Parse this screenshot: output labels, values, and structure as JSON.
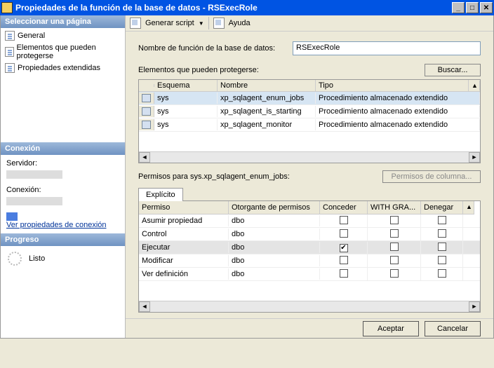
{
  "title": "Propiedades de la función de la base de datos - RSExecRole",
  "left": {
    "selectPage": "Seleccionar una página",
    "pages": [
      "General",
      "Elementos que pueden protegerse",
      "Propiedades extendidas"
    ],
    "connection": "Conexión",
    "serverLabel": "Servidor:",
    "connLabel": "Conexión:",
    "viewPropsLink": "Ver propiedades de conexión",
    "progress": "Progreso",
    "progressStatus": "Listo"
  },
  "toolbar": {
    "script": "Generar script",
    "help": "Ayuda"
  },
  "main": {
    "roleNameLabel": "Nombre de función de la base de datos:",
    "roleName": "RSExecRole",
    "securablesLabel": "Elementos que pueden protegerse:",
    "searchBtn": "Buscar...",
    "cols": {
      "schema": "Esquema",
      "name": "Nombre",
      "type": "Tipo"
    },
    "rows": [
      {
        "schema": "sys",
        "name": "xp_sqlagent_enum_jobs",
        "type": "Procedimiento almacenado extendido"
      },
      {
        "schema": "sys",
        "name": "xp_sqlagent_is_starting",
        "type": "Procedimiento almacenado extendido"
      },
      {
        "schema": "sys",
        "name": "xp_sqlagent_monitor",
        "type": "Procedimiento almacenado extendido"
      }
    ],
    "permsFor": "Permisos para sys.xp_sqlagent_enum_jobs:",
    "colPermsBtn": "Permisos de columna...",
    "tabExplicit": "Explícito",
    "permCols": {
      "perm": "Permiso",
      "grantor": "Otorgante de permisos",
      "grant": "Conceder",
      "withGrant": "WITH GRA...",
      "deny": "Denegar"
    },
    "permRows": [
      {
        "perm": "Asumir propiedad",
        "grantor": "dbo",
        "grant": false,
        "with": false,
        "deny": false
      },
      {
        "perm": "Control",
        "grantor": "dbo",
        "grant": false,
        "with": false,
        "deny": false
      },
      {
        "perm": "Ejecutar",
        "grantor": "dbo",
        "grant": true,
        "with": false,
        "deny": false
      },
      {
        "perm": "Modificar",
        "grantor": "dbo",
        "grant": false,
        "with": false,
        "deny": false
      },
      {
        "perm": "Ver definición",
        "grantor": "dbo",
        "grant": false,
        "with": false,
        "deny": false
      }
    ]
  },
  "footer": {
    "ok": "Aceptar",
    "cancel": "Cancelar"
  }
}
